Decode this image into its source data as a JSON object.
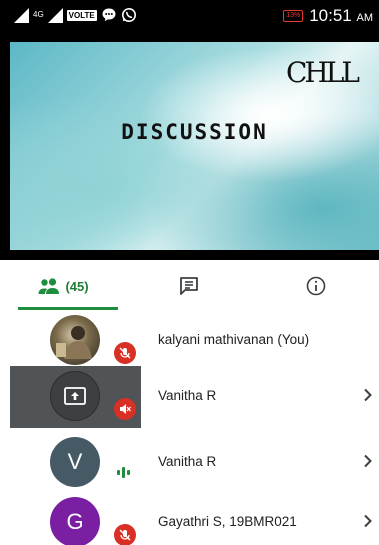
{
  "status_bar": {
    "network_label": "4G",
    "volte_label": "VOLTE",
    "battery": "13%",
    "time": "10:51",
    "ampm": "AM"
  },
  "video": {
    "title": "DISCUSSION",
    "logo_text": "CHLL"
  },
  "tabs": [
    {
      "icon": "people-icon",
      "label": "(45)",
      "active": true
    },
    {
      "icon": "chat-icon",
      "label": ""
    },
    {
      "icon": "info-icon",
      "label": ""
    }
  ],
  "participants": [
    {
      "name": "kalyani mathivanan (You)",
      "avatar": "photo",
      "status": "muted",
      "chevron": false
    },
    {
      "name": "Vanitha R",
      "avatar": "screen-share",
      "status": "muted",
      "chevron": true
    },
    {
      "name": "Vanitha R",
      "avatar_letter": "V",
      "status": "speaking",
      "chevron": true
    },
    {
      "name": "Gayathri S, 19BMR021",
      "avatar_letter": "G",
      "status": "muted",
      "chevron": true
    }
  ],
  "colors": {
    "accent_green": "#1e8e3e",
    "mute_red": "#d93025",
    "avatar_v": "#455a64",
    "avatar_g": "#7b1fa2"
  }
}
